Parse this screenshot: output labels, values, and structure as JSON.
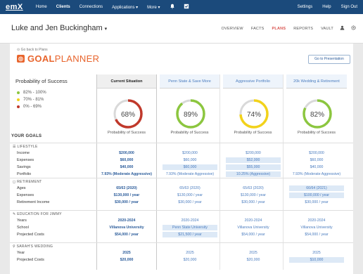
{
  "nav": {
    "logo": "emX",
    "items": [
      "Home",
      "Clients",
      "Connections",
      "Applications ▾",
      "More ▾"
    ],
    "active_index": 1,
    "right_items": [
      "Settings",
      "Help",
      "Sign Out"
    ]
  },
  "client": {
    "name": "Luke and Jen Buckingham"
  },
  "subtabs": [
    "OVERVIEW",
    "FACTS",
    "PLANS",
    "REPORTS",
    "VAULT"
  ],
  "subtab_active_index": 2,
  "back_link": "Go back to Plans",
  "goalplanner": {
    "prefix": "GOAL",
    "suffix": "PLANNER"
  },
  "present_button": "Go to Presentation",
  "probability": {
    "title": "Probability of Success",
    "legend": [
      {
        "label": "82% - 100%",
        "color": "#8cc63f"
      },
      {
        "label": "70% - 81%",
        "color": "#f2d21b"
      },
      {
        "label": "0% - 69%",
        "color": "#c0392b"
      }
    ]
  },
  "columns": [
    {
      "name": "Current Situation",
      "value": 68,
      "color": "#c0392b",
      "label": "Probability of Success"
    },
    {
      "name": "Penn State & Save More",
      "value": 89,
      "color": "#8cc63f",
      "label": "Probability of Success"
    },
    {
      "name": "Aggressive Portfolio",
      "value": 74,
      "color": "#f2d21b",
      "label": "Probability of Success"
    },
    {
      "name": "20k Wedding & Retirement",
      "value": 82,
      "color": "#8cc63f",
      "label": "Probability of Success"
    }
  ],
  "goals": {
    "title": "YOUR GOALS",
    "sections": [
      {
        "head": "LIFESTYLE",
        "rows": [
          {
            "label": "Income",
            "values": [
              "$200,000",
              "$200,000",
              "$200,000",
              "$200,000"
            ],
            "hl": [
              false,
              false,
              false,
              false
            ]
          },
          {
            "label": "Expenses",
            "values": [
              "$60,000",
              "$60,000",
              "$52,000",
              "$60,000"
            ],
            "hl": [
              false,
              false,
              true,
              false
            ]
          },
          {
            "label": "Savings",
            "values": [
              "$40,000",
              "$60,000",
              "$55,000",
              "$40,000"
            ],
            "hl": [
              false,
              true,
              true,
              false
            ]
          },
          {
            "label": "Portfolio",
            "values": [
              "7.93% (Moderate Aggressive)",
              "7.93% (Moderate Aggressive)",
              "10.25% (Aggressive)",
              "7.93% (Moderate Aggressive)"
            ],
            "hl": [
              false,
              false,
              true,
              false
            ]
          }
        ]
      },
      {
        "head": "RETIREMENT",
        "rows": [
          {
            "label": "Ages",
            "values": [
              "65/63 (2020)",
              "65/63 (2020)",
              "65/63 (2020)",
              "66/64 (2021)"
            ],
            "hl": [
              false,
              false,
              false,
              true
            ]
          },
          {
            "label": "Expenses",
            "values": [
              "$130,000 / year",
              "$130,000 / year",
              "$130,000 / year",
              "$100,000 / year"
            ],
            "hl": [
              false,
              false,
              false,
              true
            ]
          },
          {
            "label": "Retirement Income",
            "values": [
              "$30,000 / year",
              "$30,000 / year",
              "$30,000 / year",
              "$30,000 / year"
            ],
            "hl": [
              false,
              false,
              false,
              false
            ]
          }
        ]
      },
      {
        "head": "EDUCATION FOR JIMMY",
        "rows": [
          {
            "label": "Years",
            "values": [
              "2020-2024",
              "2020-2024",
              "2020-2024",
              "2020-2024"
            ],
            "hl": [
              false,
              false,
              false,
              false
            ]
          },
          {
            "label": "School",
            "values": [
              "Villanova University",
              "Penn State University",
              "Villanova University",
              "Villanova University"
            ],
            "hl": [
              false,
              true,
              false,
              false
            ]
          },
          {
            "label": "Projected Costs",
            "values": [
              "$54,000 / year",
              "$21,500 / year",
              "$54,000 / year",
              "$54,000 / year"
            ],
            "hl": [
              false,
              true,
              false,
              false
            ]
          }
        ]
      },
      {
        "head": "SARAH'S WEDDING",
        "rows": [
          {
            "label": "Year",
            "values": [
              "2025",
              "2025",
              "2025",
              "2025"
            ],
            "hl": [
              false,
              false,
              false,
              false
            ]
          },
          {
            "label": "Projected Costs",
            "values": [
              "$20,000",
              "$20,000",
              "$20,000",
              "$10,000"
            ],
            "hl": [
              false,
              false,
              false,
              true
            ]
          }
        ]
      }
    ]
  }
}
